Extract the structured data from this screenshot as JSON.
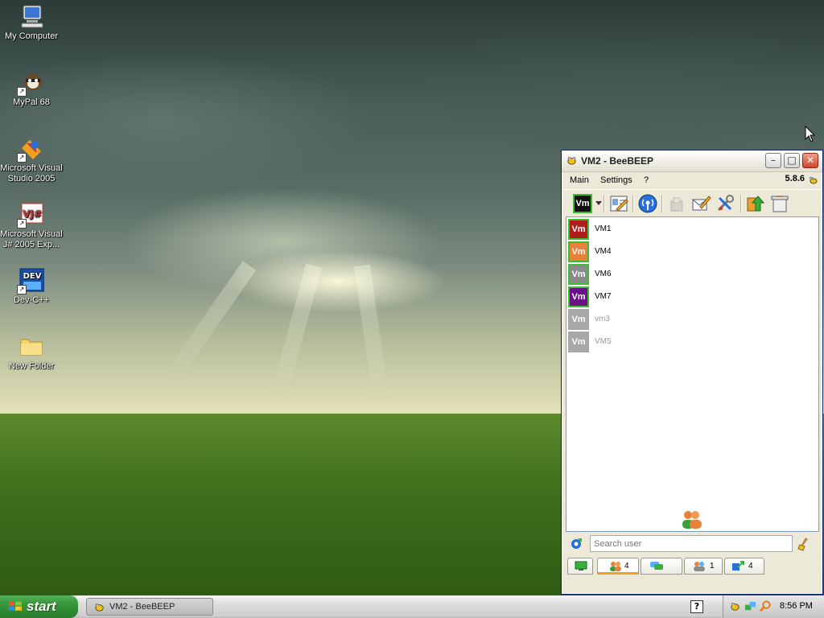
{
  "desktop": {
    "icons": [
      {
        "label": "My Computer",
        "icon": "my-computer-icon"
      },
      {
        "label": "MyPal 68",
        "icon": "mypal-icon"
      },
      {
        "label": "Microsoft Visual Studio 2005",
        "icon": "visual-studio-icon"
      },
      {
        "label": "Microsoft Visual J# 2005 Exp...",
        "icon": "visual-jsharp-icon"
      },
      {
        "label": "Dev-C++",
        "icon": "dev-cpp-icon"
      },
      {
        "label": "New Folder",
        "icon": "folder-icon"
      }
    ]
  },
  "window": {
    "title": "VM2 - BeeBEEP",
    "version": "5.8.6",
    "menu": [
      "Main",
      "Settings",
      "?"
    ],
    "toolbar_user_avatar": "Vm",
    "users": [
      {
        "avatar": "Vm",
        "name": "VM1",
        "online": true,
        "color": "#b01c1c"
      },
      {
        "avatar": "Vm",
        "name": "VM4",
        "online": true,
        "color": "#e8813a"
      },
      {
        "avatar": "Vm",
        "name": "VM6",
        "online": true,
        "color": "#8a8a8a"
      },
      {
        "avatar": "Vm",
        "name": "VM7",
        "online": true,
        "color": "#6a1088"
      },
      {
        "avatar": "Vm",
        "name": "vm3",
        "online": false,
        "color": "#a8a8a8"
      },
      {
        "avatar": "Vm",
        "name": "VM5",
        "online": false,
        "color": "#a8a8a8"
      }
    ],
    "search": {
      "placeholder": "Search user",
      "value": ""
    },
    "bottom_tabs": [
      {
        "icon": "monitor-icon",
        "count": ""
      },
      {
        "icon": "users-icon",
        "count": "4"
      },
      {
        "icon": "chat-icon",
        "count": ""
      },
      {
        "icon": "group-icon",
        "count": "1"
      },
      {
        "icon": "share-icon",
        "count": "4"
      }
    ]
  },
  "taskbar": {
    "start_label": "start",
    "items": [
      {
        "label": "VM2 - BeeBEEP"
      }
    ],
    "help_label": "?",
    "clock": "8:56 PM"
  },
  "colors": {
    "online_border": "#3cbf2f",
    "offline_text": "#9a9a9a",
    "active_tab": "#f0a020"
  }
}
